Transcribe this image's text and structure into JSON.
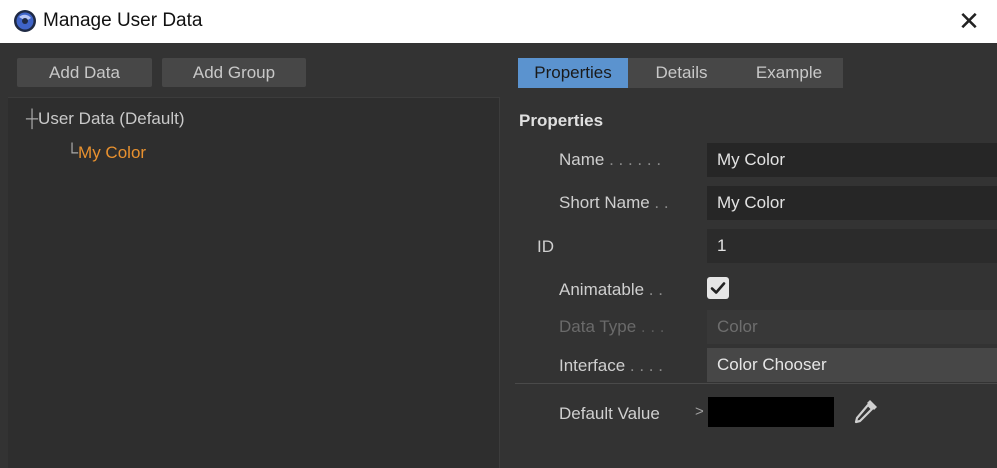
{
  "window": {
    "title": "Manage User Data",
    "app_icon": "cinema4d-logo-icon",
    "close_label": "✕"
  },
  "left": {
    "buttons": {
      "add_data": "Add Data",
      "add_group": "Add Group"
    },
    "tree": {
      "root_connector": "┼",
      "root_label": "User Data (Default)",
      "child_connector": "└",
      "child_label": "My Color",
      "child_color": "#e8912f"
    }
  },
  "right": {
    "tabs": [
      {
        "label": "Properties",
        "active": true
      },
      {
        "label": "Details",
        "active": false
      },
      {
        "label": "Example",
        "active": false
      }
    ],
    "section_title": "Properties",
    "rows": {
      "name": {
        "label": "Name",
        "dots": " . . . . . . ",
        "value": "My Color"
      },
      "short_name": {
        "label": "Short Name",
        "dots": " . . ",
        "value": "My Color"
      },
      "id": {
        "label": "ID",
        "value": "1"
      },
      "animatable": {
        "label": "Animatable",
        "dots": " . . ",
        "checked": true,
        "check_glyph": "✔"
      },
      "data_type": {
        "label": "Data Type",
        "dots": " . . . ",
        "value": "Color"
      },
      "interface": {
        "label": "Interface",
        "dots": " . . . . ",
        "value": "Color Chooser"
      },
      "default_value": {
        "label": "Default Value",
        "arrow": ">",
        "color": "#000000",
        "picker_icon": "eyedropper-icon"
      }
    }
  },
  "colors": {
    "background": "#333333",
    "accent_tab": "#5b93cf",
    "highlight_text": "#e8912f"
  }
}
